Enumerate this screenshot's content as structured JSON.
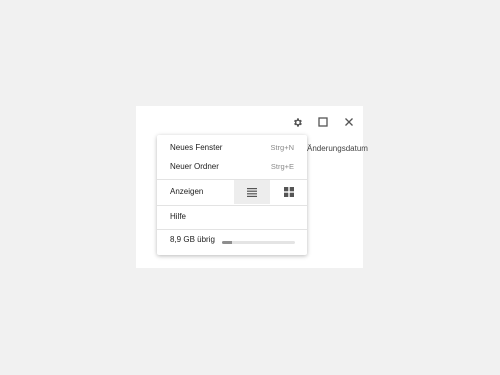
{
  "window": {
    "background_column_text": "Änderungsdatum",
    "buttons": [
      {
        "icon": "gear-icon"
      },
      {
        "icon": "maximize-icon"
      },
      {
        "icon": "close-icon"
      }
    ]
  },
  "menu": {
    "items": [
      {
        "label": "Neues Fenster",
        "shortcut": "Strg+N"
      },
      {
        "label": "Neuer Ordner",
        "shortcut": "Strg+E"
      }
    ],
    "view": {
      "label": "Anzeigen",
      "options": [
        {
          "icon": "list-view-icon",
          "selected": true
        },
        {
          "icon": "grid-view-icon",
          "selected": false
        }
      ]
    },
    "help_label": "Hilfe",
    "storage": {
      "label": "8,9 GB übrig",
      "used_fraction": 0.14
    }
  },
  "colors": {
    "page_background": "#f1f1f1",
    "selected_view_background": "#ededed",
    "icon": "#555555"
  }
}
